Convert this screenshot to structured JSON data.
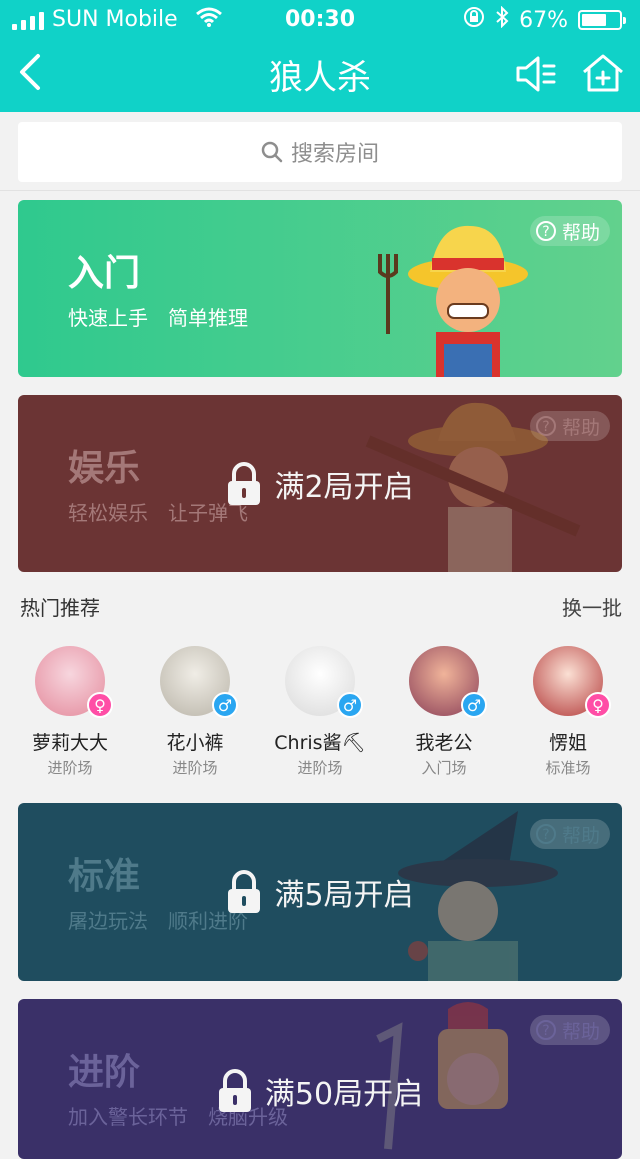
{
  "status_bar": {
    "carrier": "SUN Mobile",
    "time": "00:30",
    "battery_text": "67%",
    "battery_level": 0.67
  },
  "nav": {
    "title": "狼人杀",
    "icons": [
      "back-chevron-icon",
      "speaker-icon",
      "home-add-icon"
    ]
  },
  "search": {
    "placeholder": "搜索房间"
  },
  "cards": {
    "intro": {
      "title": "入门",
      "subtitle": "快速上手　简单推理",
      "help": "帮助"
    },
    "entertain": {
      "title": "娱乐",
      "subtitle": "轻松娱乐　让子弹飞",
      "help": "帮助",
      "lock_text": "满2局开启"
    },
    "standard": {
      "title": "标准",
      "subtitle": "屠边玩法　顺利进阶",
      "help": "帮助",
      "lock_text": "满5局开启"
    },
    "advanced": {
      "title": "进阶",
      "subtitle": "加入警长环节　烧脑升级",
      "help": "帮助",
      "lock_text": "满50局开启"
    }
  },
  "hot": {
    "heading": "热门推荐",
    "refresh": "换一批",
    "users": [
      {
        "name": "萝莉大大",
        "rank": "进阶场",
        "gender": "female",
        "gender_symbol": "♀"
      },
      {
        "name": "花小裤",
        "rank": "进阶场",
        "gender": "male",
        "gender_symbol": "♂"
      },
      {
        "name": "Chris酱⛏",
        "rank": "进阶场",
        "gender": "male",
        "gender_symbol": "♂"
      },
      {
        "name": "我老公",
        "rank": "入门场",
        "gender": "male",
        "gender_symbol": "♂"
      },
      {
        "name": "愣姐",
        "rank": "标准场",
        "gender": "female",
        "gender_symbol": "♀"
      }
    ]
  },
  "colors": {
    "header": "#10d2c8",
    "intro": "#2fc98e",
    "entertain": "#6b3434",
    "standard": "#1f4d5f",
    "advanced": "#3a3068",
    "female": "#ff4ea6",
    "male": "#2aa6f1"
  }
}
